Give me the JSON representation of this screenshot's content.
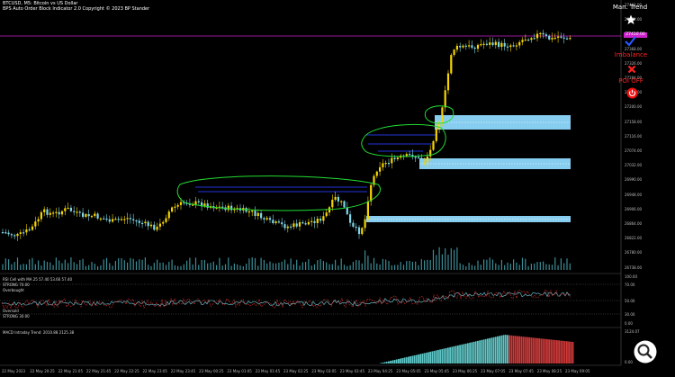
{
  "header": {
    "symbol_line": "BTCUSD, M5: Bitcoin vs US Dollar",
    "indicator_line": "BPS Auto Order Block Indicator 2.0 Copyright © 2023 BP Stander"
  },
  "controls": {
    "man_trend": "Man. Trend",
    "imbalance": "Imbalance",
    "poi_off": "POI OFF"
  },
  "price_axis": {
    "labels": [
      "27494.00",
      "27452.00",
      "27410.00",
      "27368.00",
      "27326.00",
      "27284.00",
      "27242.00",
      "27200.00",
      "27158.00",
      "27116.00",
      "27074.00",
      "27032.00",
      "26990.00",
      "26948.00",
      "26906.00",
      "26864.00",
      "26822.00",
      "26780.00",
      "26738.00"
    ],
    "current_price": "27410.00"
  },
  "rsi_panel": {
    "title": "RSI Cell with MA 25 57.40 53.66 57.40",
    "overbought_label": "STRONG 70.00",
    "overbought_text": "Overbought",
    "oversold_label": "Oversold",
    "oversold_strong": "STRONG 30.00",
    "axis": [
      "100.00",
      "70.00",
      "50.00",
      "30.00",
      "0.00"
    ]
  },
  "macd_panel": {
    "title": "MACD Intraday Trend: 2010.88 2125.38",
    "axis": [
      "3124.07",
      "0.00"
    ]
  },
  "time_axis": [
    "22 May 2023",
    "22 May 20:25",
    "22 May 21:05",
    "22 May 21:45",
    "22 May 22:25",
    "22 May 23:05",
    "22 May 23:45",
    "23 May 00:25",
    "23 May 01:05",
    "23 May 01:45",
    "23 May 02:25",
    "23 May 03:05",
    "23 May 03:45",
    "23 May 04:25",
    "23 May 05:05",
    "23 May 05:45",
    "23 May 06:25",
    "23 May 07:05",
    "23 May 07:45",
    "23 May 08:25",
    "23 May 09:05"
  ],
  "colors": {
    "bull": "#f5d400",
    "bear": "#7fd6e8",
    "order_block": "#87cdef",
    "ellipse": "#22dd33",
    "price_line": "#cc22cc",
    "macd_up": "#5fc7c8",
    "macd_down": "#d23a3a"
  },
  "icons": {
    "man_trend": "star-icon",
    "check": "checkmark-icon",
    "imbalance": "close-icon",
    "poi": "power-icon"
  }
}
